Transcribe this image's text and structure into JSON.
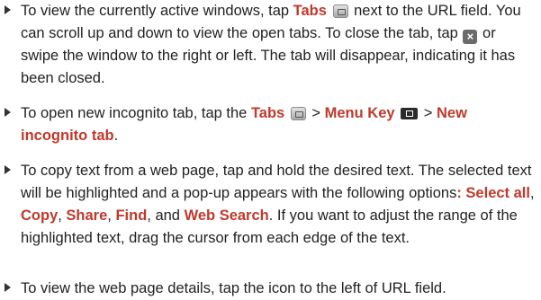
{
  "bullets": [
    {
      "t1": "To view the currently active windows, tap ",
      "tabs": "Tabs",
      "t2": " next to the URL field. You can scroll up and down to view the open tabs. To close the tab, tap ",
      "t3": " or swipe the window to the right or left. The tab will disappear, indicating it has been closed."
    },
    {
      "t1": "To open new incognito tab, tap the ",
      "tabs": "Tabs",
      "sep1": " > ",
      "menu_key": "Menu Key",
      "sep2": " > ",
      "new_incognito": "New incognito tab",
      "t2": "."
    },
    {
      "t1": "To copy text from a web page, tap and hold the desired text. The selected text will be highlighted and a pop-up appears with the following options",
      "colon": ": ",
      "select_all": "Select all",
      "c1": ", ",
      "copy": "Copy",
      "c2": ", ",
      "share": "Share",
      "c3": ", ",
      "find": "Find",
      "c4": ", and ",
      "web_search": "Web Search",
      "t2": ". If you want to adjust the range of the highlighted text, drag the cursor from each edge of the text."
    },
    {
      "t1": "To view the web page details, tap the icon to the left of URL field."
    }
  ],
  "icons": {
    "tabs": "tabs-icon",
    "close": "close-icon",
    "menu_key": "menu-key-icon"
  }
}
